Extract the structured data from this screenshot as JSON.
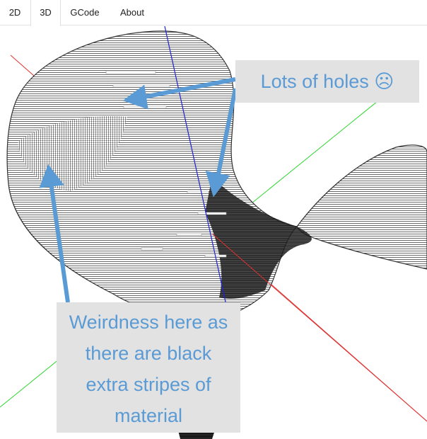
{
  "tabs": [
    {
      "label": "2D",
      "active": false
    },
    {
      "label": "3D",
      "active": true
    },
    {
      "label": "GCode",
      "active": false
    },
    {
      "label": "About",
      "active": false
    }
  ],
  "annotations": {
    "holes": "Lots of holes ☹",
    "weirdness": [
      "Weirdness here as",
      "there are black",
      "extra stripes of",
      "material"
    ]
  },
  "colors": {
    "axis_x": "#e03030",
    "axis_y": "#2bd62b",
    "axis_z": "#2020e0",
    "annotation_text": "#5b9bd5",
    "annotation_box": "#e2e2e2",
    "arrow": "#5b9bd5"
  },
  "icons": {
    "model": "wireframe-hyperboloid-mesh",
    "arrows": "annotation-arrow-icon"
  }
}
